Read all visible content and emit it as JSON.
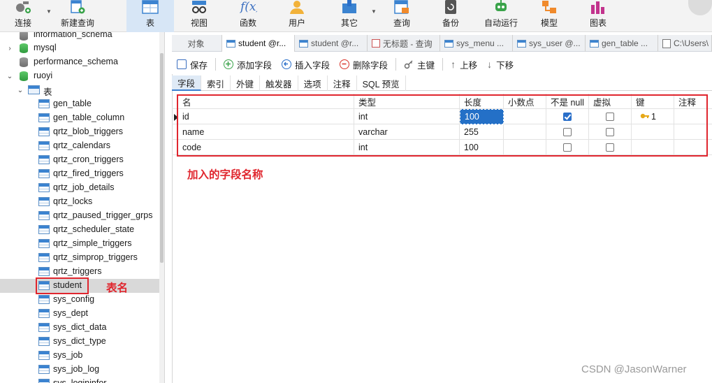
{
  "toolbar": {
    "buttons": [
      {
        "label": "连接",
        "icon": "plug-icon"
      },
      {
        "label": "新建查询",
        "icon": "new-query-icon"
      },
      {
        "label": "表",
        "icon": "table-icon"
      },
      {
        "label": "视图",
        "icon": "view-icon"
      },
      {
        "label": "函数",
        "icon": "function-icon"
      },
      {
        "label": "用户",
        "icon": "user-icon"
      },
      {
        "label": "其它",
        "icon": "other-icon"
      },
      {
        "label": "查询",
        "icon": "query-icon"
      },
      {
        "label": "备份",
        "icon": "backup-icon"
      },
      {
        "label": "自动运行",
        "icon": "automation-icon"
      },
      {
        "label": "模型",
        "icon": "model-icon"
      },
      {
        "label": "图表",
        "icon": "chart-icon"
      }
    ]
  },
  "tree": {
    "databases": [
      {
        "name": "information_schema"
      },
      {
        "name": "mysql"
      },
      {
        "name": "performance_schema"
      },
      {
        "name": "ruoyi"
      }
    ],
    "tables_folder": "表",
    "tables": [
      "gen_table",
      "gen_table_column",
      "qrtz_blob_triggers",
      "qrtz_calendars",
      "qrtz_cron_triggers",
      "qrtz_fired_triggers",
      "qrtz_job_details",
      "qrtz_locks",
      "qrtz_paused_trigger_grps",
      "qrtz_scheduler_state",
      "qrtz_simple_triggers",
      "qrtz_simprop_triggers",
      "qrtz_triggers",
      "student",
      "sys_config",
      "sys_dept",
      "sys_dict_data",
      "sys_dict_type",
      "sys_job",
      "sys_job_log",
      "sys_logininfor"
    ],
    "selected": "student"
  },
  "tabs": [
    {
      "label": "对象"
    },
    {
      "label": "student @r..."
    },
    {
      "label": "student @r..."
    },
    {
      "label": "无标题 - 查询"
    },
    {
      "label": "sys_menu ..."
    },
    {
      "label": "sys_user @..."
    },
    {
      "label": "gen_table ..."
    },
    {
      "label": "C:\\Users\\"
    }
  ],
  "actions": {
    "save": "保存",
    "add_field": "添加字段",
    "insert_field": "插入字段",
    "delete_field": "删除字段",
    "primary_key": "主键",
    "move_up": "上移",
    "move_down": "下移"
  },
  "subtabs": [
    "字段",
    "索引",
    "外键",
    "触发器",
    "选项",
    "注释",
    "SQL 预览"
  ],
  "grid": {
    "columns": [
      "名",
      "类型",
      "长度",
      "小数点",
      "不是 null",
      "虚拟",
      "键",
      "注释"
    ],
    "rows": [
      {
        "name": "id",
        "type": "int",
        "length": "100",
        "decimals": "",
        "not_null": true,
        "virtual": false,
        "key": "1",
        "comment": ""
      },
      {
        "name": "name",
        "type": "varchar",
        "length": "255",
        "decimals": "",
        "not_null": false,
        "virtual": false,
        "key": "",
        "comment": ""
      },
      {
        "name": "code",
        "type": "int",
        "length": "100",
        "decimals": "",
        "not_null": false,
        "virtual": false,
        "key": "",
        "comment": ""
      }
    ]
  },
  "annotations": {
    "fields_note": "加入的字段名称",
    "table_note": "表名"
  },
  "watermark": "CSDN @JasonWarner",
  "colors": {
    "accent": "#2470c7",
    "annotation_red": "#e0262e",
    "selected_row": "#d9d9d9"
  }
}
